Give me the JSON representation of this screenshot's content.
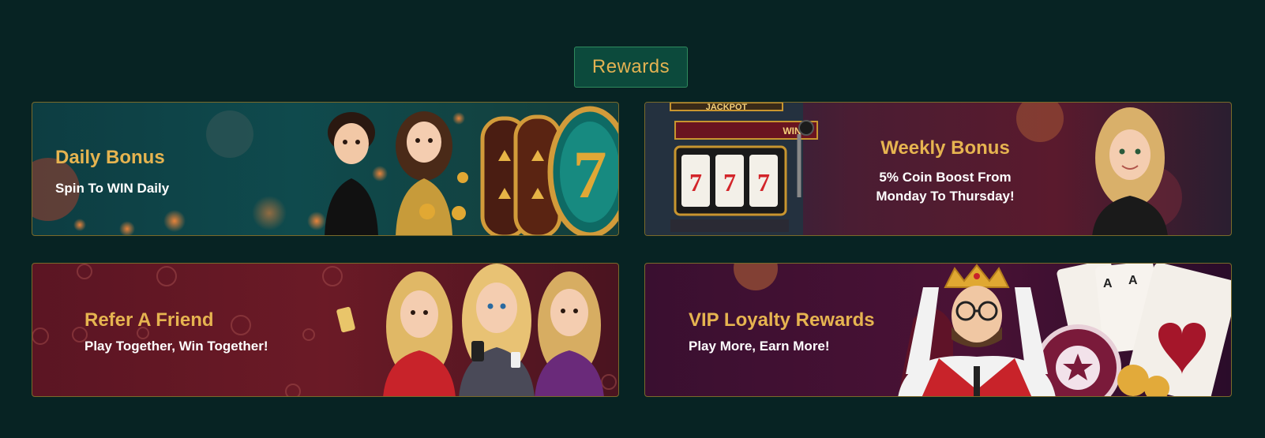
{
  "section": {
    "title": "Rewards"
  },
  "cards": [
    {
      "title": "Daily Bonus",
      "subtitle": "Spin To WIN Daily"
    },
    {
      "title": "Weekly Bonus",
      "subtitle_line1": "5% Coin Boost From",
      "subtitle_line2": "Monday To Thursday!"
    },
    {
      "title": "Refer A Friend",
      "subtitle": "Play Together, Win Together!"
    },
    {
      "title": "VIP Loyalty Rewards",
      "subtitle": "Play More, Earn More!"
    }
  ],
  "machine": {
    "top_sign": "JACKPOT",
    "wins_label": "WINS",
    "reel_symbol": "7"
  },
  "colors": {
    "background": "#072323",
    "gold": "#e6b450",
    "badge": "#0c4a3c"
  }
}
